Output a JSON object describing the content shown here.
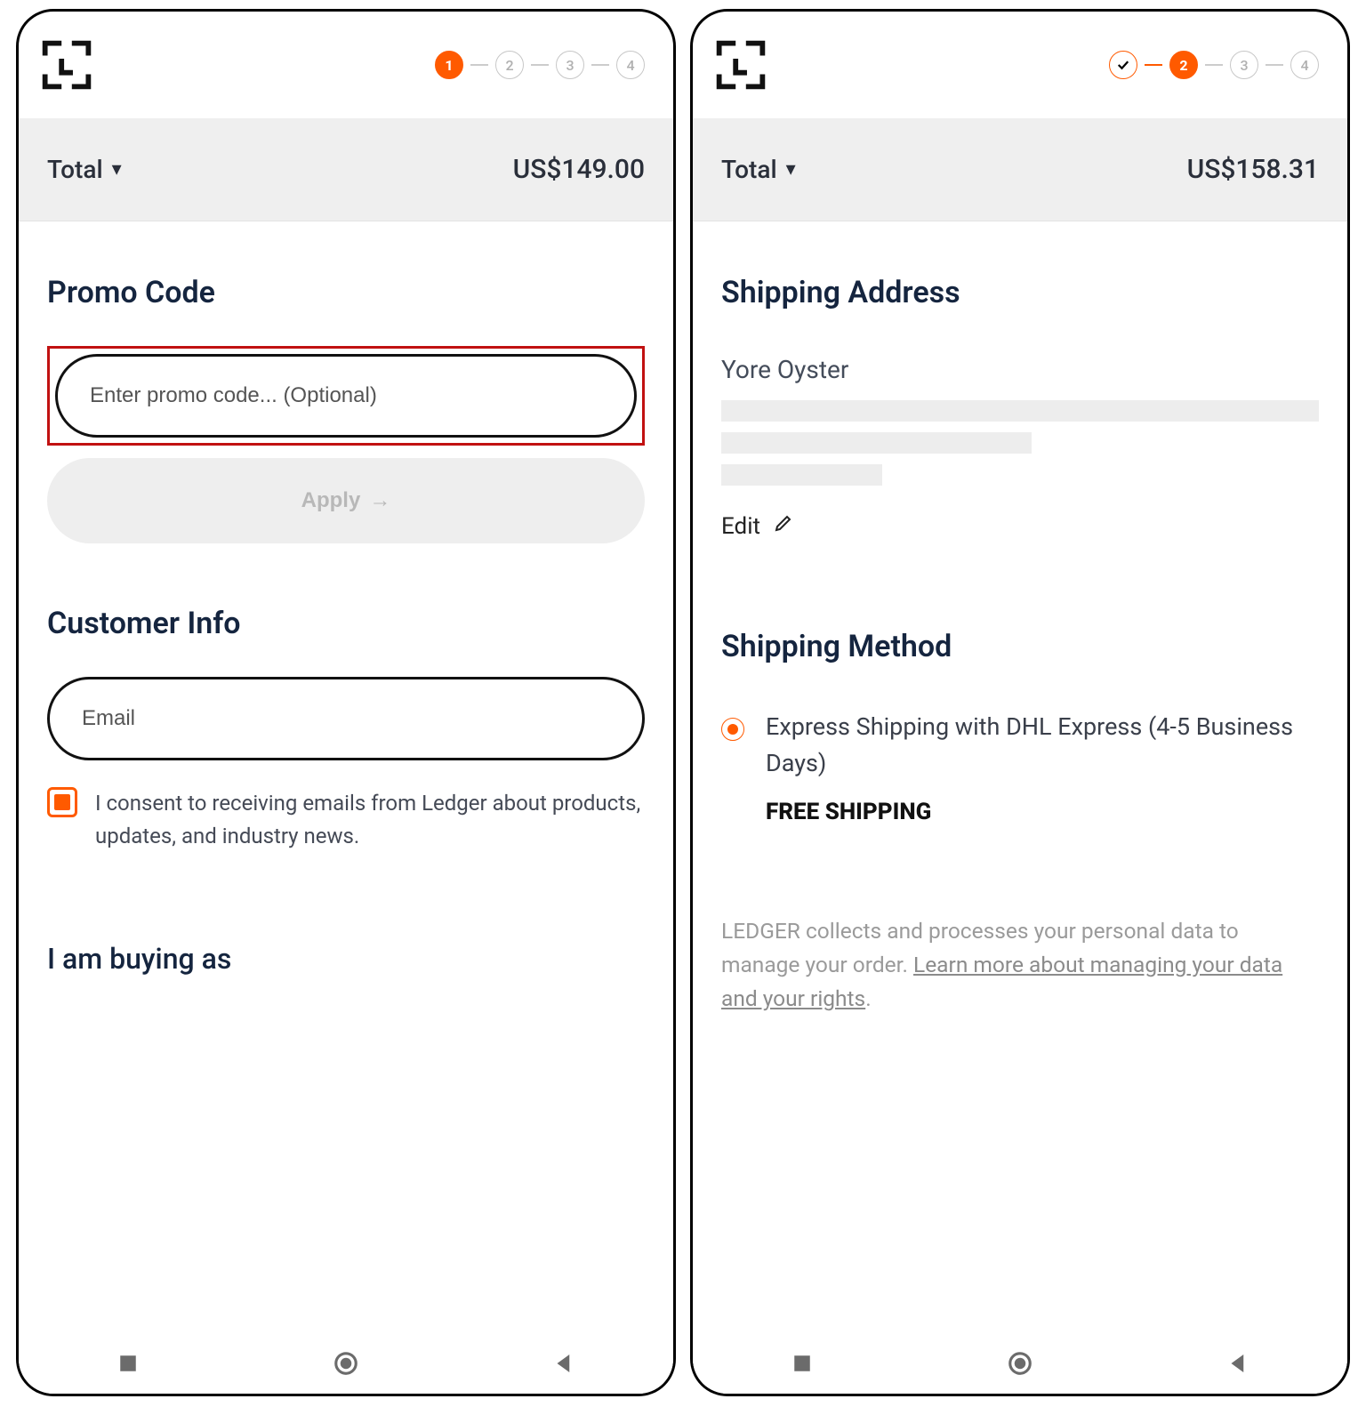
{
  "left": {
    "steps": [
      "1",
      "2",
      "3",
      "4"
    ],
    "active_step": 1,
    "total_label": "Total",
    "total_value": "US$149.00",
    "promo": {
      "title": "Promo Code",
      "placeholder": "Enter promo code... (Optional)",
      "apply": "Apply"
    },
    "customer": {
      "title": "Customer Info",
      "email_placeholder": "Email",
      "consent": "I consent to receiving emails from Ledger about products, updates, and industry news."
    },
    "buying_title": "I am buying as"
  },
  "right": {
    "steps": [
      "1",
      "2",
      "3",
      "4"
    ],
    "active_step": 2,
    "total_label": "Total",
    "total_value": "US$158.31",
    "shipping_address_title": "Shipping Address",
    "name": "Yore Oyster",
    "edit": "Edit",
    "shipping_method_title": "Shipping Method",
    "method_label": "Express Shipping with DHL Express (4-5 Business Days)",
    "free": "FREE SHIPPING",
    "disclaimer_a": "LEDGER collects and processes your personal data to manage your order. ",
    "disclaimer_link": "Learn more about managing your data and your rights",
    "disclaimer_b": "."
  }
}
